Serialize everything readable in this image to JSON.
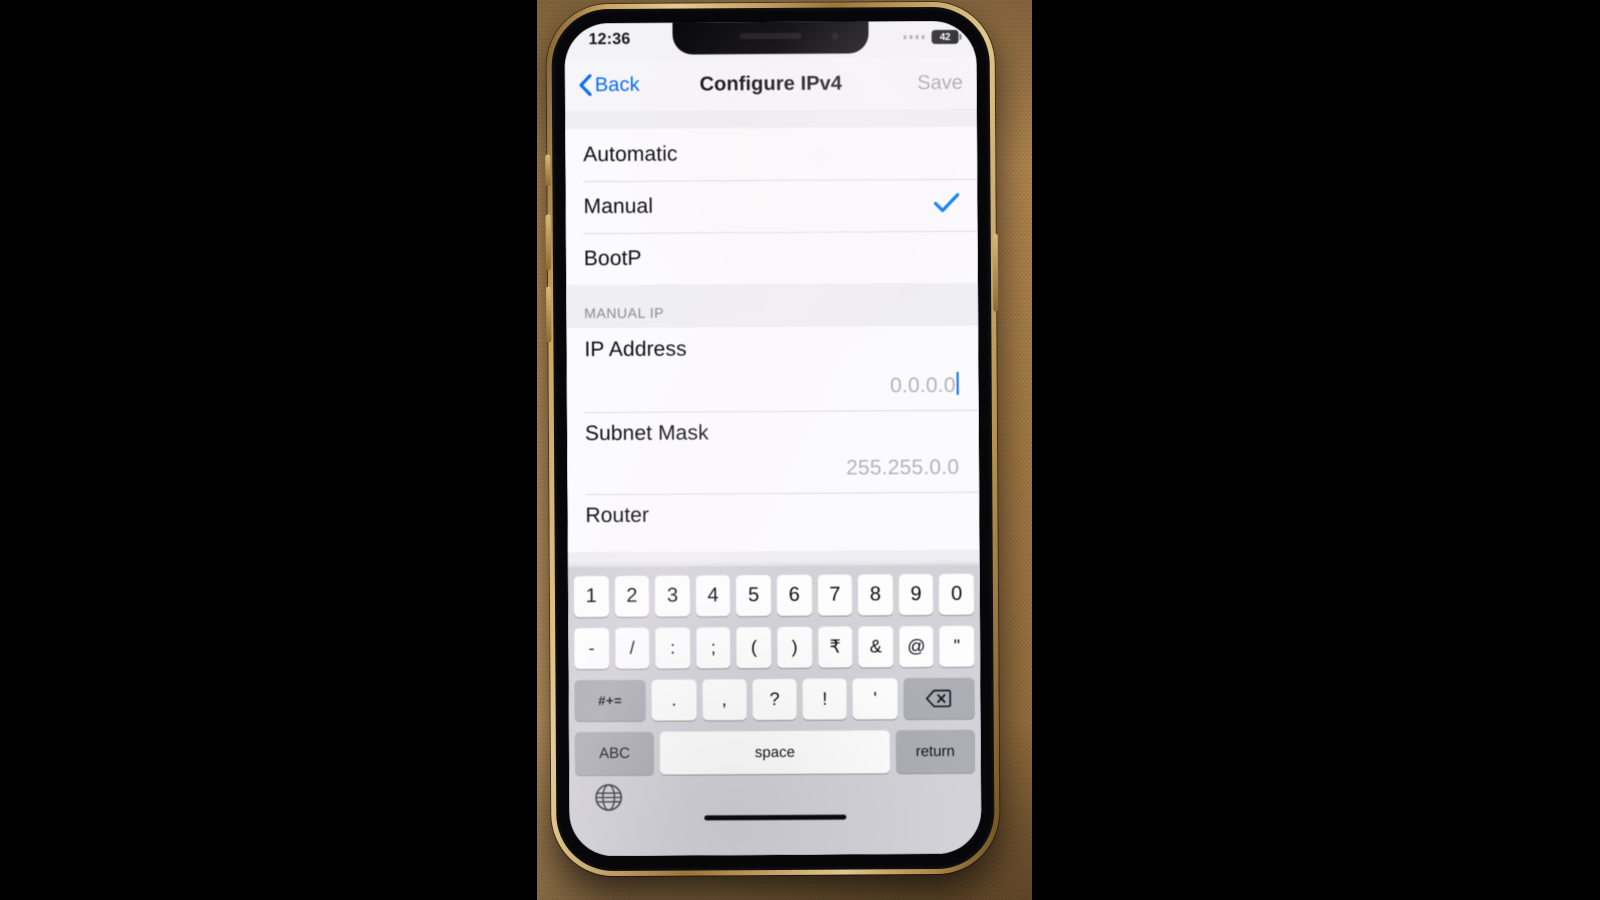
{
  "status_bar": {
    "time": "12:36",
    "battery_level": "42",
    "signal_icon": "signal-dots-icon",
    "battery_icon": "battery-icon"
  },
  "nav_bar": {
    "back_label": "Back",
    "back_icon": "chevron-left-icon",
    "title": "Configure IPv4",
    "save_label": "Save",
    "save_enabled": false,
    "accent_color": "#0b6df2",
    "disabled_color": "#a8a5ad"
  },
  "mode_options": [
    {
      "label": "Automatic",
      "selected": false
    },
    {
      "label": "Manual",
      "selected": true
    },
    {
      "label": "BootP",
      "selected": false
    }
  ],
  "checkmark": {
    "icon": "checkmark-icon",
    "color": "#007AFF"
  },
  "manual_ip": {
    "section_header": "MANUAL IP",
    "fields": [
      {
        "label": "IP Address",
        "value": "0.0.0.0",
        "focused": true
      },
      {
        "label": "Subnet Mask",
        "value": "255.255.0.0",
        "focused": false
      },
      {
        "label": "Router",
        "value": "",
        "focused": false
      }
    ]
  },
  "keyboard": {
    "row1": [
      "1",
      "2",
      "3",
      "4",
      "5",
      "6",
      "7",
      "8",
      "9",
      "0"
    ],
    "row2": [
      "-",
      "/",
      ":",
      ";",
      "(",
      ")",
      "₹",
      "&",
      "@",
      "\""
    ],
    "row3_toggle": "#+=",
    "row3": [
      ".",
      ",",
      "?",
      "!",
      "'"
    ],
    "backspace_icon": "backspace-icon",
    "bottom": {
      "abc_label": "ABC",
      "space_label": "space",
      "return_label": "return"
    },
    "globe_icon": "globe-icon"
  }
}
